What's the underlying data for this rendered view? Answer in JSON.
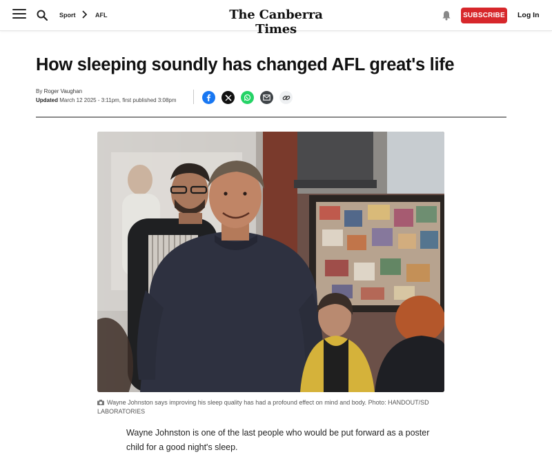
{
  "header": {
    "breadcrumb": [
      "Sport",
      "AFL"
    ],
    "logo_text": "The Canberra Times",
    "subscribe_label": "SUBSCRIBE",
    "login_label": "Log In",
    "accent_color": "#d7272b"
  },
  "article": {
    "headline": "How sleeping soundly has changed AFL great's life",
    "byline_prefix": "By",
    "author": "Roger Vaughan",
    "updated_label": "Updated",
    "updated_text": "March 12 2025 - 3:11pm, first published 3:08pm",
    "share_icons": [
      "facebook-icon",
      "x-icon",
      "whatsapp-icon",
      "email-icon",
      "link-icon"
    ],
    "caption": "Wayne Johnston says improving his sleep quality has had a profound effect on mind and body. Photo: HANDOUT/SD LABORATORIES",
    "body_lead": "Wayne Johnston is one of the last people who would be put forward as a poster child for a good night's sleep."
  }
}
